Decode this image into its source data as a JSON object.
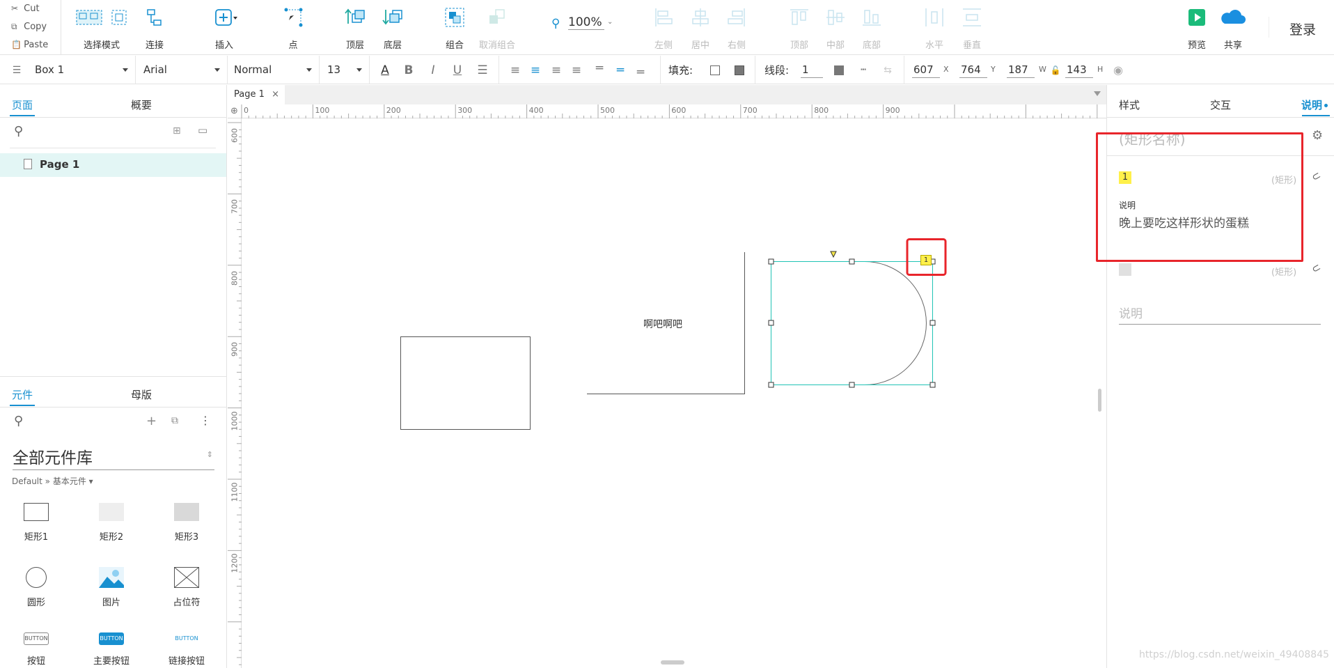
{
  "clipboard": {
    "cut": "Cut",
    "copy": "Copy",
    "paste": "Paste"
  },
  "toolbar": {
    "select_mode": "选择模式",
    "connect": "连接",
    "insert": "插入",
    "point": "点",
    "top_layer": "顶层",
    "bottom_layer": "底层",
    "group": "组合",
    "ungroup": "取消组合",
    "zoom": "100%",
    "align_left": "左侧",
    "align_center": "居中",
    "align_right": "右侧",
    "align_top": "顶部",
    "align_middle": "中部",
    "align_bottom": "底部",
    "dist_horizontal": "水平",
    "dist_vertical": "垂直",
    "preview": "预览",
    "share": "共享",
    "login": "登录"
  },
  "format": {
    "widget_name": "Box 1",
    "font": "Arial",
    "font_style": "Normal",
    "font_size": "13",
    "fill_label": "填充:",
    "stroke_label": "线段:",
    "stroke_width": "1",
    "x": "607",
    "y": "764",
    "w": "187",
    "h": "143",
    "x_label": "X",
    "y_label": "Y",
    "w_label": "W",
    "h_label": "H"
  },
  "left": {
    "tab_pages": "页面",
    "tab_outline": "概要",
    "page_name": "Page 1",
    "tab_widgets": "元件",
    "tab_masters": "母版",
    "library_title": "全部元件库",
    "library_path": "Default » 基本元件 ▾",
    "widgets": [
      {
        "label": "矩形1"
      },
      {
        "label": "矩形2"
      },
      {
        "label": "矩形3"
      },
      {
        "label": "圆形"
      },
      {
        "label": "图片"
      },
      {
        "label": "占位符"
      },
      {
        "label": "按钮",
        "thumb": "BUTTON"
      },
      {
        "label": "主要按钮",
        "thumb": "BUTTON"
      },
      {
        "label": "链接按钮",
        "thumb": "BUTTON"
      }
    ]
  },
  "canvas": {
    "page_tab": "Page 1",
    "ruler_h": [
      "0",
      "100",
      "200",
      "300",
      "400",
      "500",
      "600",
      "700",
      "800",
      "900"
    ],
    "ruler_v": [
      "600",
      "700",
      "800",
      "900",
      "1000",
      "1100",
      "1200"
    ],
    "text_label": "啊吧啊吧",
    "note_badge": "1"
  },
  "right": {
    "tab_style": "样式",
    "tab_interact": "交互",
    "tab_notes": "说明",
    "shape_name_placeholder": "(矩形名称)",
    "note1_badge": "1",
    "note1_type": "(矩形)",
    "note1_field": "说明",
    "note1_text": "晚上要吃这样形状的蛋糕",
    "note2_type": "(矩形)",
    "note2_placeholder": "说明"
  },
  "watermark": "https://blog.csdn.net/weixin_49408845",
  "colors": {
    "accent": "#1890d0",
    "selection": "#20c3b5",
    "highlight_box": "#e8252b",
    "note_badge": "#fff04a",
    "preview": "#1bbb7a",
    "share": "#1a8fe0"
  }
}
